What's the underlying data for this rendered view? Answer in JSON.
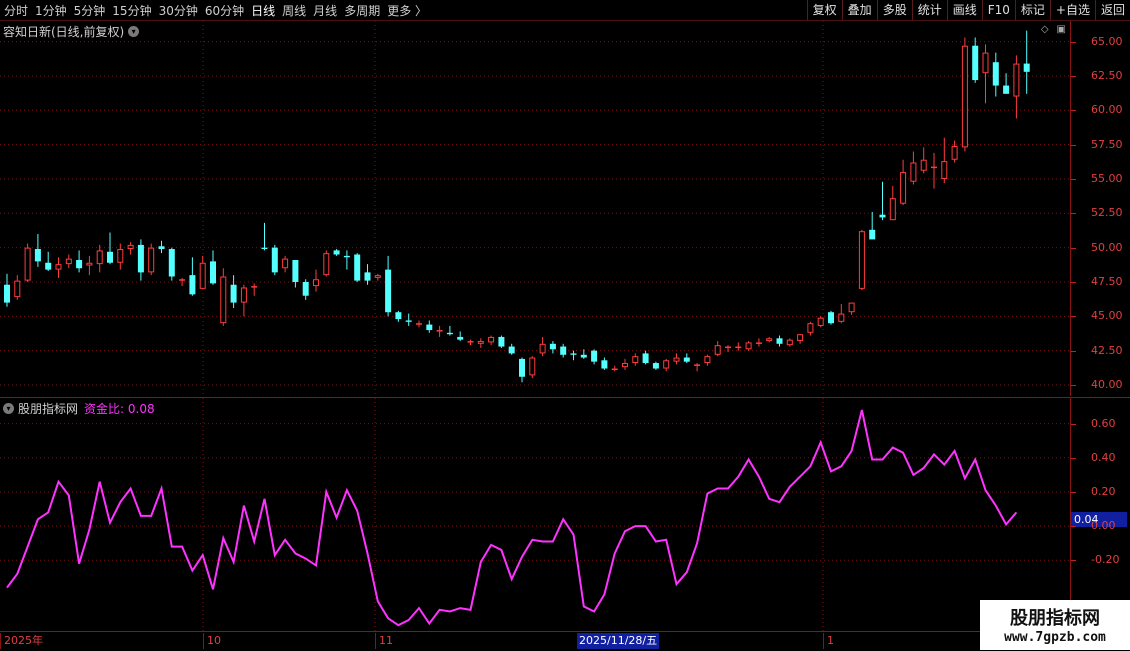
{
  "toolbar": {
    "left_items": [
      "分时",
      "1分钟",
      "5分钟",
      "15分钟",
      "30分钟",
      "60分钟",
      "日线",
      "周线",
      "月线",
      "多周期",
      "更多 〉"
    ],
    "active_item": "日线",
    "right_items": [
      "复权",
      "叠加",
      "多股",
      "统计",
      "画线",
      "F10",
      "标记",
      "+自选",
      "返回"
    ]
  },
  "main_panel": {
    "title": "容知日新(日线,前复权)",
    "icon": "chevron-down-icon",
    "price_ticks": [
      "65.00",
      "62.50",
      "60.00",
      "57.50",
      "55.00",
      "52.50",
      "50.00",
      "47.50",
      "45.00",
      "42.50",
      "40.00"
    ]
  },
  "indicator_panel": {
    "name": "股朋指标网",
    "label": "资金比: 0.08",
    "ticks": [
      "0.60",
      "0.40",
      "0.20",
      "0.00",
      "-0.20"
    ],
    "current_value": "0.04"
  },
  "date_axis": {
    "labels": [
      "2025年",
      "10",
      "11",
      "1"
    ],
    "highlight": "2025/11/28/五"
  },
  "watermark": {
    "line1": "股朋指标网",
    "line2": "www.7gpzb.com"
  },
  "colors": {
    "up": "#ff3c3c",
    "down": "#54ffff",
    "indicator": "#ff33ff",
    "grid": "#8a1414"
  },
  "chart_data": [
    {
      "type": "candlestick",
      "title": "容知日新(日线,前复权)",
      "ylim": [
        39.2,
        66.5
      ],
      "candles": [
        [
          47.3,
          48.1,
          45.7,
          46.0
        ],
        [
          46.4,
          48.0,
          46.2,
          47.6
        ],
        [
          47.6,
          50.3,
          47.5,
          50.0
        ],
        [
          49.9,
          51.0,
          48.6,
          49.0
        ],
        [
          48.9,
          49.7,
          48.3,
          48.4
        ],
        [
          48.4,
          49.3,
          47.8,
          48.8
        ],
        [
          48.8,
          49.5,
          48.5,
          49.2
        ],
        [
          49.1,
          49.8,
          48.2,
          48.5
        ],
        [
          48.7,
          49.4,
          48.0,
          48.9
        ],
        [
          48.8,
          50.2,
          48.2,
          49.8
        ],
        [
          49.7,
          51.1,
          48.8,
          48.9
        ],
        [
          48.9,
          50.3,
          48.4,
          49.9
        ],
        [
          49.9,
          50.4,
          49.5,
          50.2
        ],
        [
          50.2,
          50.6,
          47.6,
          48.2
        ],
        [
          48.2,
          50.3,
          48.0,
          50.0
        ],
        [
          50.1,
          50.5,
          49.6,
          49.9
        ],
        [
          49.9,
          50.0,
          47.6,
          47.9
        ],
        [
          47.7,
          47.8,
          47.2,
          47.7
        ],
        [
          48.0,
          49.3,
          46.5,
          46.6
        ],
        [
          47.0,
          49.4,
          47.0,
          48.9
        ],
        [
          49.0,
          49.8,
          47.3,
          47.4
        ],
        [
          44.5,
          48.5,
          44.3,
          47.9
        ],
        [
          47.3,
          48.0,
          45.6,
          46.0
        ],
        [
          46.0,
          47.3,
          45.0,
          47.1
        ],
        [
          47.1,
          47.4,
          46.5,
          47.2
        ],
        [
          50.0,
          51.8,
          49.8,
          49.9
        ],
        [
          50.0,
          50.2,
          48.0,
          48.2
        ],
        [
          48.5,
          49.4,
          48.2,
          49.2
        ],
        [
          49.1,
          49.1,
          47.1,
          47.5
        ],
        [
          47.5,
          47.7,
          46.2,
          46.5
        ],
        [
          47.2,
          48.4,
          46.8,
          47.7
        ],
        [
          48.0,
          49.8,
          47.9,
          49.6
        ],
        [
          49.8,
          49.9,
          49.4,
          49.5
        ],
        [
          49.4,
          49.8,
          48.4,
          49.3
        ],
        [
          49.5,
          49.6,
          47.5,
          47.6
        ],
        [
          48.2,
          48.8,
          47.3,
          47.6
        ],
        [
          47.8,
          48.1,
          47.6,
          48.0
        ],
        [
          48.4,
          49.4,
          45.0,
          45.3
        ],
        [
          45.3,
          45.4,
          44.6,
          44.8
        ],
        [
          44.7,
          45.2,
          44.3,
          44.6
        ],
        [
          44.4,
          44.7,
          44.2,
          44.5
        ],
        [
          44.4,
          44.7,
          43.8,
          44.0
        ],
        [
          43.9,
          44.3,
          43.5,
          44.0
        ],
        [
          43.8,
          44.3,
          43.6,
          43.7
        ],
        [
          43.5,
          43.9,
          43.2,
          43.3
        ],
        [
          43.1,
          43.3,
          42.9,
          43.2
        ],
        [
          43.0,
          43.4,
          42.7,
          43.2
        ],
        [
          43.1,
          43.6,
          42.9,
          43.5
        ],
        [
          43.5,
          43.6,
          42.7,
          42.8
        ],
        [
          42.8,
          43.0,
          42.2,
          42.3
        ],
        [
          41.9,
          42.0,
          40.2,
          40.6
        ],
        [
          40.7,
          42.1,
          40.5,
          42.0
        ],
        [
          42.3,
          43.5,
          42.1,
          43.0
        ],
        [
          43.0,
          43.2,
          42.3,
          42.6
        ],
        [
          42.8,
          43.0,
          42.0,
          42.2
        ],
        [
          42.3,
          42.5,
          41.8,
          42.2
        ],
        [
          42.2,
          42.6,
          41.9,
          42.0
        ],
        [
          42.5,
          42.6,
          41.5,
          41.7
        ],
        [
          41.8,
          42.0,
          41.1,
          41.2
        ],
        [
          41.2,
          41.4,
          41.0,
          41.2
        ],
        [
          41.3,
          41.9,
          41.1,
          41.6
        ],
        [
          41.6,
          42.3,
          41.4,
          42.1
        ],
        [
          42.3,
          42.5,
          41.5,
          41.6
        ],
        [
          41.6,
          41.7,
          41.1,
          41.2
        ],
        [
          41.2,
          41.9,
          41.0,
          41.8
        ],
        [
          41.7,
          42.3,
          41.5,
          42.0
        ],
        [
          42.0,
          42.3,
          41.6,
          41.7
        ],
        [
          41.4,
          41.6,
          41.0,
          41.5
        ],
        [
          41.6,
          42.2,
          41.4,
          42.1
        ],
        [
          42.2,
          43.2,
          42.1,
          42.9
        ],
        [
          42.7,
          42.9,
          42.4,
          42.8
        ],
        [
          42.7,
          43.1,
          42.5,
          42.8
        ],
        [
          42.6,
          43.2,
          42.5,
          43.1
        ],
        [
          43.0,
          43.4,
          42.8,
          43.1
        ],
        [
          43.2,
          43.5,
          43.1,
          43.4
        ],
        [
          43.4,
          43.6,
          42.8,
          43.0
        ],
        [
          42.9,
          43.4,
          42.8,
          43.3
        ],
        [
          43.2,
          43.7,
          43.0,
          43.7
        ],
        [
          43.8,
          44.6,
          43.6,
          44.5
        ],
        [
          44.3,
          45.0,
          44.2,
          44.9
        ],
        [
          45.3,
          45.4,
          44.4,
          44.5
        ],
        [
          44.6,
          45.9,
          44.5,
          45.2
        ],
        [
          45.3,
          46.0,
          45.1,
          46.0
        ],
        [
          47.0,
          51.3,
          46.9,
          51.2
        ],
        [
          51.3,
          52.6,
          50.7,
          50.6
        ],
        [
          52.4,
          54.8,
          52.0,
          52.2
        ],
        [
          52.0,
          54.5,
          52.0,
          53.6
        ],
        [
          53.2,
          56.4,
          53.1,
          55.5
        ],
        [
          54.8,
          57.0,
          54.6,
          56.2
        ],
        [
          55.6,
          57.3,
          55.4,
          56.4
        ],
        [
          55.8,
          56.9,
          54.3,
          55.9
        ],
        [
          55.0,
          58.0,
          54.7,
          56.3
        ],
        [
          56.4,
          57.8,
          56.2,
          57.4
        ],
        [
          57.3,
          65.3,
          57.0,
          64.7
        ],
        [
          64.7,
          65.3,
          62.0,
          62.2
        ],
        [
          62.7,
          64.8,
          60.5,
          64.2
        ],
        [
          63.5,
          64.2,
          61.0,
          61.8
        ],
        [
          61.8,
          62.7,
          61.2,
          61.2
        ],
        [
          61.0,
          64.0,
          59.4,
          63.4
        ],
        [
          63.4,
          65.8,
          61.2,
          62.8
        ]
      ]
    },
    {
      "type": "line",
      "title": "股朋指标网",
      "series": [
        {
          "name": "资金比",
          "values": [
            -0.36,
            -0.28,
            -0.12,
            0.04,
            0.08,
            0.26,
            0.18,
            -0.22,
            -0.02,
            0.26,
            0.02,
            0.14,
            0.22,
            0.06,
            0.06,
            0.22,
            -0.12,
            -0.12,
            -0.26,
            -0.17,
            -0.37,
            -0.07,
            -0.21,
            0.12,
            -0.09,
            0.16,
            -0.17,
            -0.08,
            -0.16,
            -0.19,
            -0.23,
            0.2,
            0.05,
            0.21,
            0.09,
            -0.16,
            -0.44,
            -0.54,
            -0.58,
            -0.55,
            -0.48,
            -0.57,
            -0.49,
            -0.5,
            -0.48,
            -0.49,
            -0.21,
            -0.11,
            -0.14,
            -0.31,
            -0.18,
            -0.08,
            -0.09,
            -0.09,
            0.04,
            -0.05,
            -0.47,
            -0.5,
            -0.4,
            -0.16,
            -0.03,
            0.0,
            0.0,
            -0.09,
            -0.08,
            -0.34,
            -0.27,
            -0.1,
            0.19,
            0.22,
            0.22,
            0.29,
            0.39,
            0.29,
            0.16,
            0.14,
            0.23,
            0.29,
            0.35,
            0.49,
            0.32,
            0.35,
            0.44,
            0.68,
            0.39,
            0.39,
            0.46,
            0.43,
            0.3,
            0.34,
            0.42,
            0.36,
            0.44,
            0.28,
            0.39,
            0.21,
            0.12,
            0.01,
            0.08
          ]
        }
      ],
      "ylim": [
        -0.62,
        0.75
      ]
    }
  ]
}
